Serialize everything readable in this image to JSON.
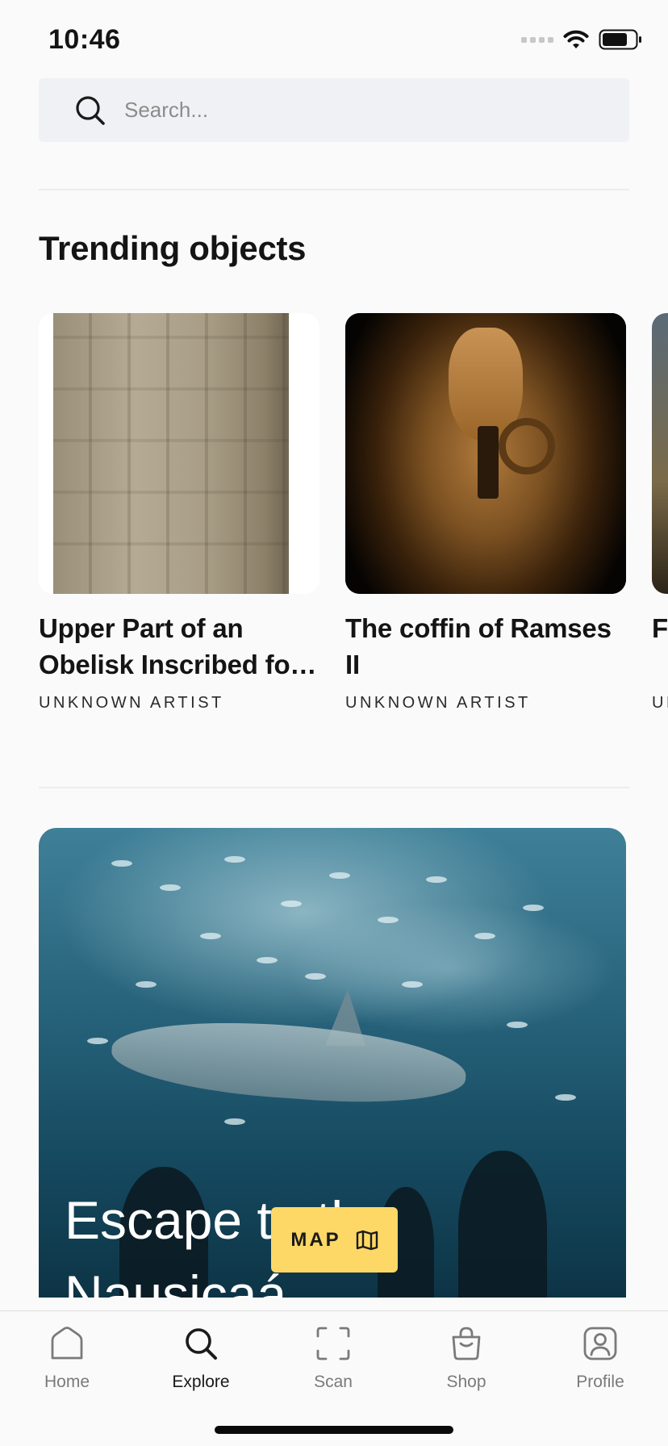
{
  "status_bar": {
    "time": "10:46"
  },
  "search": {
    "placeholder": "Search..."
  },
  "trending": {
    "title": "Trending objects",
    "items": [
      {
        "title": "Upper Part of an Obelisk Inscribed fo…",
        "artist": "UNKNOWN ARTIST"
      },
      {
        "title": "The coffin of Ramses II",
        "artist": "UNKNOWN ARTIST"
      },
      {
        "title": "Fr",
        "artist": "UN"
      }
    ]
  },
  "promo": {
    "title": "Escape to the Nausicaá"
  },
  "map_button": {
    "label": "MAP"
  },
  "tab_bar": {
    "active": "Explore",
    "tabs": [
      {
        "label": "Home",
        "icon": "home-icon"
      },
      {
        "label": "Explore",
        "icon": "search-icon"
      },
      {
        "label": "Scan",
        "icon": "scan-icon"
      },
      {
        "label": "Shop",
        "icon": "shopping-bag-icon"
      },
      {
        "label": "Profile",
        "icon": "profile-icon"
      }
    ]
  },
  "colors": {
    "accent_yellow": "#fdd866",
    "background": "#fafafa",
    "search_bg": "#f0f1f4"
  }
}
